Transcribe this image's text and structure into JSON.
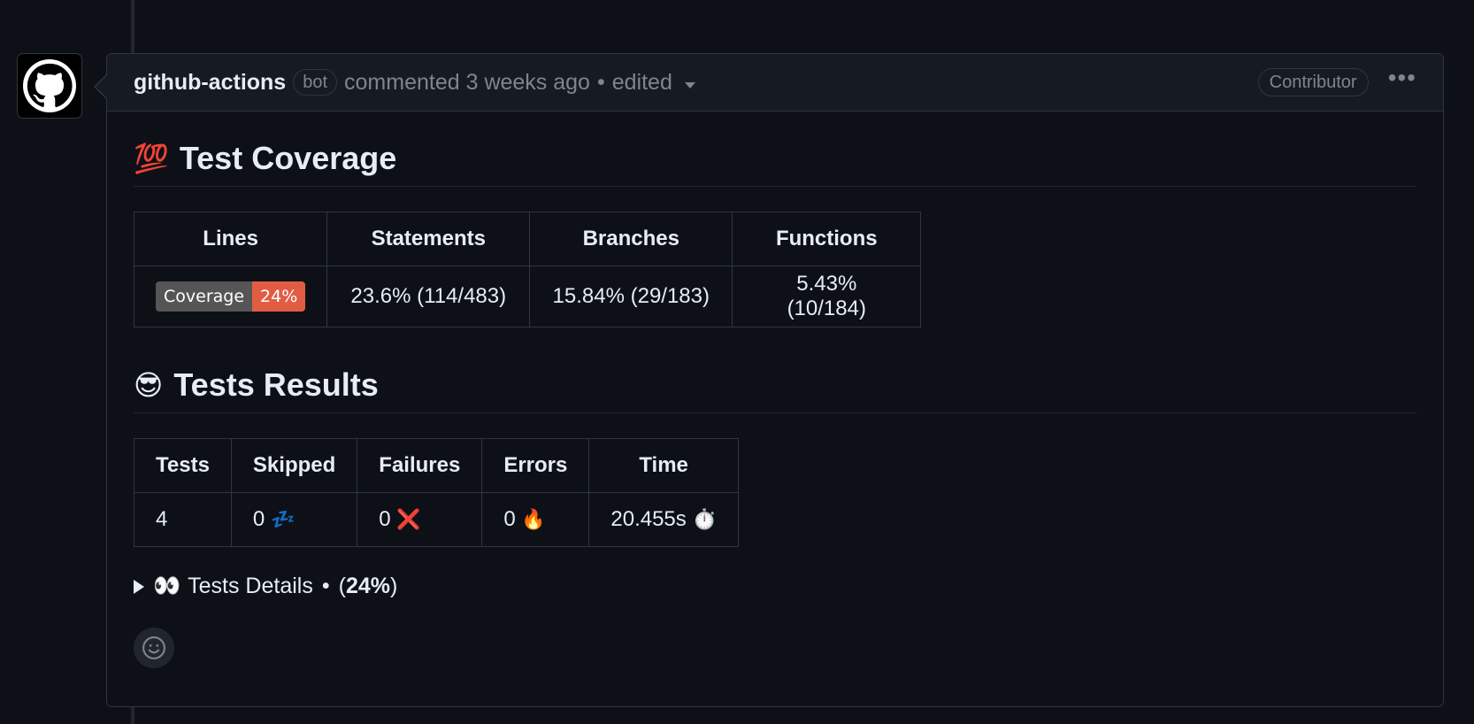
{
  "comment": {
    "author": "github-actions",
    "bot_label": "bot",
    "meta_text": "commented 3 weeks ago",
    "separator": "•",
    "edited": "edited",
    "role_badge": "Contributor",
    "more_menu": "•••",
    "avatar_icon": "github-octocat-icon"
  },
  "coverage": {
    "emoji": "💯",
    "heading": "Test Coverage",
    "headers": [
      "Lines",
      "Statements",
      "Branches",
      "Functions"
    ],
    "badge_label": "Coverage",
    "badge_value": "24%",
    "badge_colors": {
      "label": "#555555",
      "value": "#e05d44"
    },
    "statements": "23.6% (114/483)",
    "branches": "15.84% (29/183)",
    "functions": "5.43% (10/184)"
  },
  "tests": {
    "emoji": "😎",
    "heading": "Tests Results",
    "headers": [
      "Tests",
      "Skipped",
      "Failures",
      "Errors",
      "Time"
    ],
    "tests": "4",
    "skipped": "0",
    "skipped_icon": "💤",
    "failures": "0",
    "failures_icon": "❌",
    "errors": "0",
    "errors_icon": "🔥",
    "time": "20.455s",
    "time_icon": "⏱️"
  },
  "details": {
    "emoji": "👀",
    "label": "Tests Details",
    "separator": "•",
    "percent": "24%"
  },
  "reaction": {
    "icon": "smiley-icon"
  }
}
